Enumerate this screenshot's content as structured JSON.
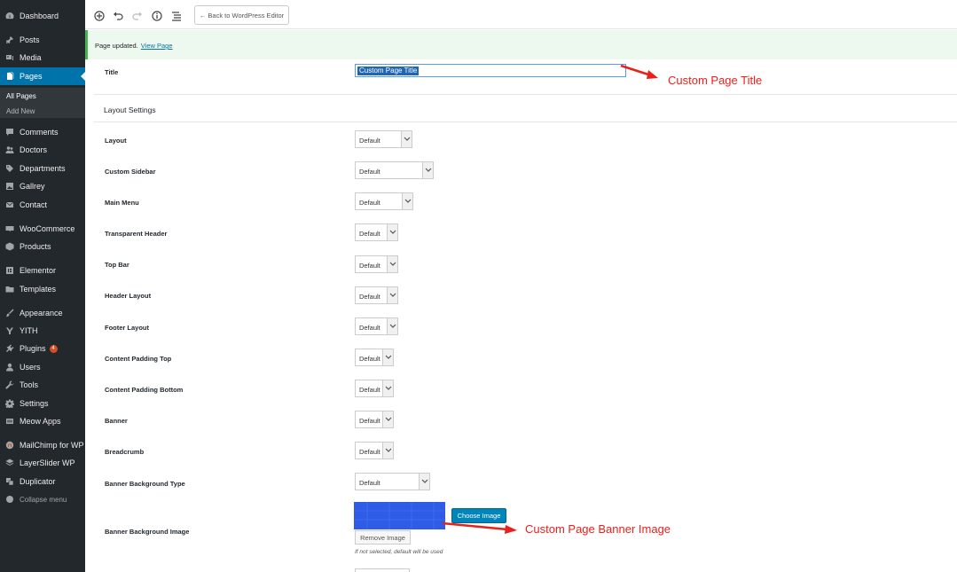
{
  "sidebar": {
    "items": [
      {
        "label": "Dashboard"
      },
      {
        "label": "Posts"
      },
      {
        "label": "Media"
      },
      {
        "label": "Pages"
      },
      {
        "label": "Comments"
      },
      {
        "label": "Doctors"
      },
      {
        "label": "Departments"
      },
      {
        "label": "Gallrey"
      },
      {
        "label": "Contact"
      },
      {
        "label": "WooCommerce"
      },
      {
        "label": "Products"
      },
      {
        "label": "Elementor"
      },
      {
        "label": "Templates"
      },
      {
        "label": "Appearance"
      },
      {
        "label": "YITH"
      },
      {
        "label": "Plugins",
        "badge": "4"
      },
      {
        "label": "Users"
      },
      {
        "label": "Tools"
      },
      {
        "label": "Settings"
      },
      {
        "label": "Meow Apps"
      },
      {
        "label": "MailChimp for WP"
      },
      {
        "label": "LayerSlider WP"
      },
      {
        "label": "Duplicator"
      }
    ],
    "pages_submenu": [
      "All Pages",
      "Add New"
    ],
    "collapse_label": "Collapse menu"
  },
  "toolbar": {
    "back_label": "← Back to WordPress Editor",
    "icons": [
      "add-block-icon",
      "undo-icon",
      "redo-icon",
      "info-icon",
      "outline-icon"
    ]
  },
  "notice": {
    "text": "Page updated.",
    "link": "View Page"
  },
  "form": {
    "title_label": "Title",
    "title_value": "Custom Page Title",
    "section_title": "Layout Settings",
    "fields": [
      {
        "label": "Layout",
        "value": "Default"
      },
      {
        "label": "Custom Sidebar",
        "value": "Default"
      },
      {
        "label": "Main Menu",
        "value": "Default"
      },
      {
        "label": "Transparent Header",
        "value": "Default"
      },
      {
        "label": "Top Bar",
        "value": "Default"
      },
      {
        "label": "Header Layout",
        "value": "Default"
      },
      {
        "label": "Footer Layout",
        "value": "Default"
      },
      {
        "label": "Content Padding Top",
        "value": "Default"
      },
      {
        "label": "Content Padding Bottom",
        "value": "Default"
      },
      {
        "label": "Banner",
        "value": "Default"
      },
      {
        "label": "Breadcrumb",
        "value": "Default"
      },
      {
        "label": "Banner Background Type",
        "value": "Default"
      }
    ],
    "banner_image_label": "Banner Background Image",
    "choose_image": "Choose Image",
    "remove_image": "Remove Image",
    "hint": "If not selected, default will be used"
  },
  "annotations": {
    "title_note": "Custom Page Title",
    "banner_note": "Custom Page Banner Image",
    "color": "#e8211c"
  },
  "colors": {
    "sidebar_bg": "#23282d",
    "accent": "#0073aa",
    "button_primary": "#0085ba",
    "notice_border": "#46b450"
  }
}
